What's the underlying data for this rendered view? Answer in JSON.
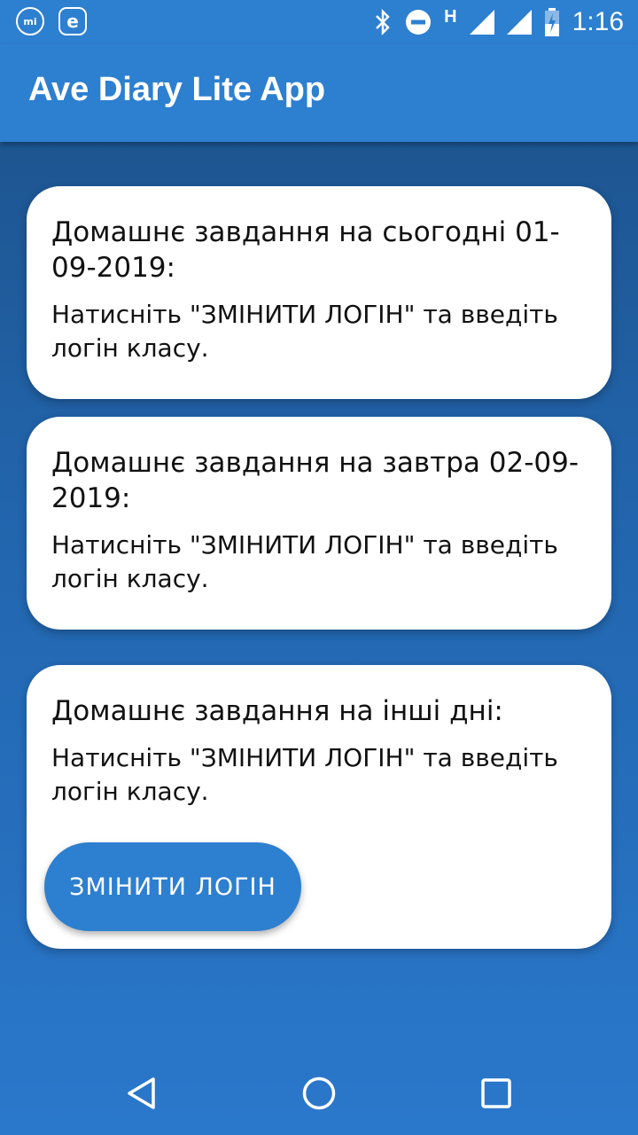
{
  "status_bar": {
    "app_icon_1": "mi",
    "app_icon_2": "e",
    "network": "H",
    "time": "1:16"
  },
  "app_bar": {
    "title": "Ave Diary Lite App"
  },
  "cards": [
    {
      "title": "Домашнє завдання на сьогодні 01-09-2019:",
      "text": "Натисніть \"ЗМІНИТИ ЛОГІН\" та введіть логін класу."
    },
    {
      "title": "Домашнє завдання на завтра 02-09-2019:",
      "text": "Натисніть \"ЗМІНИТИ ЛОГІН\" та введіть логін класу."
    },
    {
      "title": "Домашнє завдання на інші дні:",
      "text": "Натисніть \"ЗМІНИТИ ЛОГІН\" та введіть логін класу."
    }
  ],
  "change_login_button": "ЗМІНИТИ ЛОГІН",
  "icons": [
    "bluetooth-icon",
    "do-not-disturb-icon",
    "signal-icon",
    "battery-icon",
    "back-icon",
    "home-icon",
    "recents-icon"
  ],
  "colors": {
    "primary": "#2d7fd0",
    "card": "#ffffff",
    "text": "#111111"
  }
}
